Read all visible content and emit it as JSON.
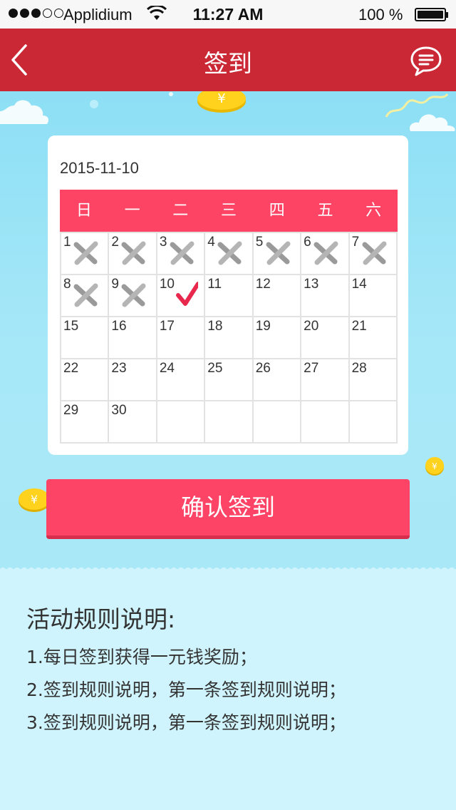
{
  "status_bar": {
    "carrier": "Applidium",
    "time": "11:27 AM",
    "battery": "100 %"
  },
  "nav": {
    "title": "签到",
    "back_icon": "chevron-left-icon",
    "message_icon": "chat-bubble-icon"
  },
  "calendar": {
    "date": "2015-11-10",
    "weekdays": [
      "日",
      "一",
      "二",
      "三",
      "四",
      "五",
      "六"
    ],
    "days": [
      {
        "n": "1",
        "mark": "missed"
      },
      {
        "n": "2",
        "mark": "missed"
      },
      {
        "n": "3",
        "mark": "missed"
      },
      {
        "n": "4",
        "mark": "missed"
      },
      {
        "n": "5",
        "mark": "missed"
      },
      {
        "n": "6",
        "mark": "missed"
      },
      {
        "n": "7",
        "mark": "missed"
      },
      {
        "n": "8",
        "mark": "missed"
      },
      {
        "n": "9",
        "mark": "missed"
      },
      {
        "n": "10",
        "mark": "checked"
      },
      {
        "n": "11",
        "mark": ""
      },
      {
        "n": "12",
        "mark": ""
      },
      {
        "n": "13",
        "mark": ""
      },
      {
        "n": "14",
        "mark": ""
      },
      {
        "n": "15",
        "mark": ""
      },
      {
        "n": "16",
        "mark": ""
      },
      {
        "n": "17",
        "mark": ""
      },
      {
        "n": "18",
        "mark": ""
      },
      {
        "n": "19",
        "mark": ""
      },
      {
        "n": "20",
        "mark": ""
      },
      {
        "n": "21",
        "mark": ""
      },
      {
        "n": "22",
        "mark": ""
      },
      {
        "n": "23",
        "mark": ""
      },
      {
        "n": "24",
        "mark": ""
      },
      {
        "n": "25",
        "mark": ""
      },
      {
        "n": "26",
        "mark": ""
      },
      {
        "n": "27",
        "mark": ""
      },
      {
        "n": "28",
        "mark": ""
      },
      {
        "n": "29",
        "mark": ""
      },
      {
        "n": "30",
        "mark": ""
      },
      {
        "n": "",
        "mark": ""
      },
      {
        "n": "",
        "mark": ""
      },
      {
        "n": "",
        "mark": ""
      },
      {
        "n": "",
        "mark": ""
      },
      {
        "n": "",
        "mark": ""
      }
    ]
  },
  "confirm_button": "确认签到",
  "rules": {
    "title": "活动规则说明:",
    "items": [
      "1.每日签到获得一元钱奖励；",
      "2.签到规则说明，第一条签到规则说明；",
      "3.签到规则说明，第一条签到规则说明；"
    ]
  },
  "colors": {
    "nav": "#cb2835",
    "accent": "#fe4465",
    "sky": "#9ee4f6",
    "rules_bg": "#cff4fd"
  }
}
